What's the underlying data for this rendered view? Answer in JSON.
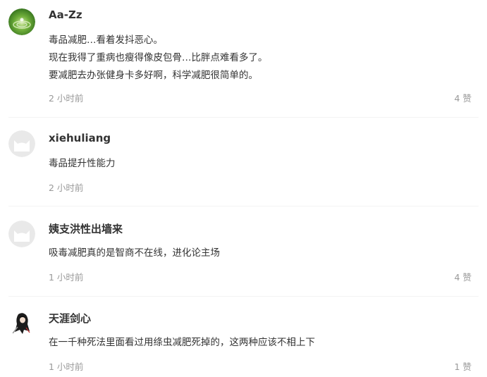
{
  "comments": [
    {
      "username": "Aa-Zz",
      "lines": [
        "毒品减肥…看着发抖恶心。",
        "现在我得了重病也瘦得像皮包骨…比胖点难看多了。",
        "要减肥去办张健身卡多好啊，科学减肥很简单的。"
      ],
      "time": "2 小时前",
      "likes": "4 赞"
    },
    {
      "username": "xiehuliang",
      "lines": [
        "毒品提升性能力"
      ],
      "time": "2 小时前",
      "likes": ""
    },
    {
      "username": "姨支洪性出墙来",
      "lines": [
        "吸毒减肥真的是智商不在线，进化论主场"
      ],
      "time": "1 小时前",
      "likes": "4 赞"
    },
    {
      "username": "天涯剑心",
      "lines": [
        "在一千种死法里面看过用绦虫减肥死掉的，这两种应该不相上下"
      ],
      "time": "1 小时前",
      "likes": "1 赞"
    }
  ]
}
